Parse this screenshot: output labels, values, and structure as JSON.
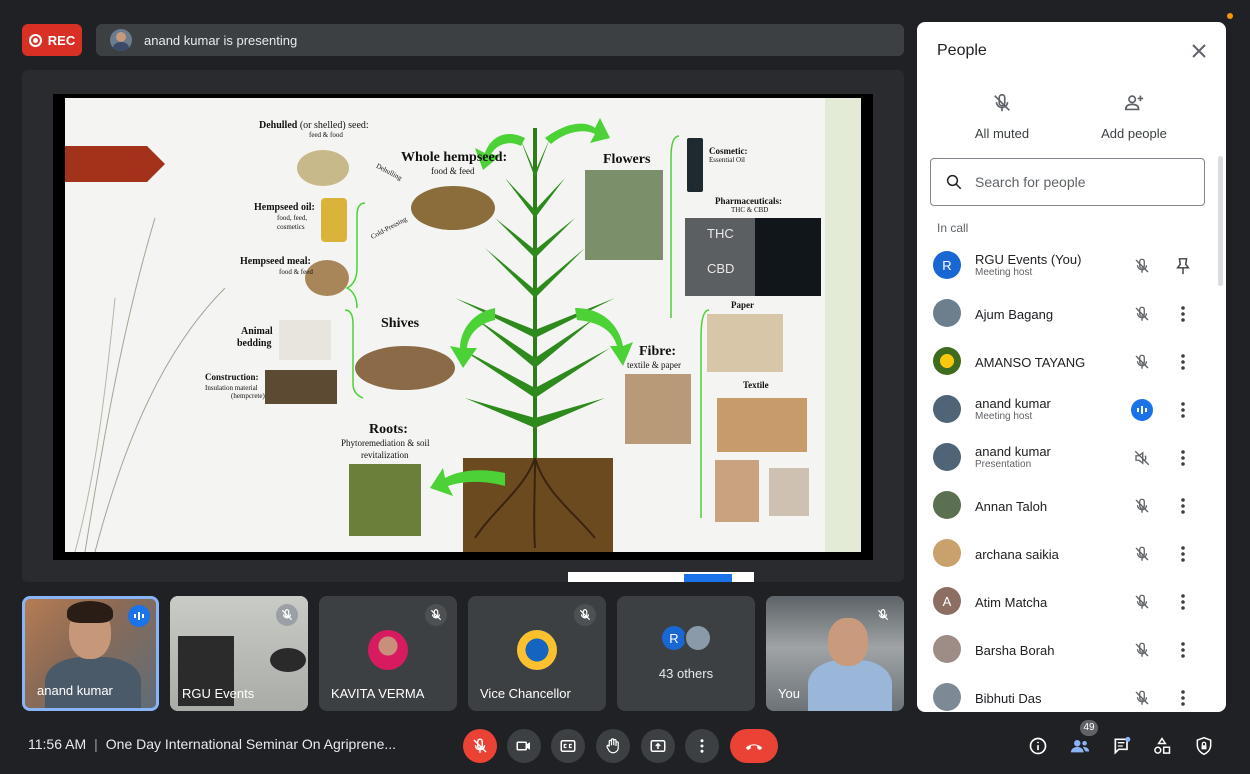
{
  "topbar": {
    "rec_label": "REC",
    "presenting_text": "anand kumar is presenting"
  },
  "slide": {
    "dehulled_title": "Dehulled",
    "dehulled_rest": "(or shelled) seed:",
    "dehulled_sub": "feed & food",
    "whole_title": "Whole hempseed:",
    "whole_sub": "food & feed",
    "dehulling": "Dehulling",
    "cold_pressing": "Cold-Pressing",
    "oil_title": "Hempseed oil:",
    "oil_sub1": "food, feed,",
    "oil_sub2": "cosmetics",
    "meal_title": "Hempseed meal:",
    "meal_sub": "food & feed",
    "animal_title1": "Animal",
    "animal_title2": "bedding",
    "shives_title": "Shives",
    "construction_title": "Construction:",
    "construction_sub1": "Insulation material",
    "construction_sub2": "(hempcrete)",
    "roots_title": "Roots:",
    "roots_sub1": "Phytoremediation & soil",
    "roots_sub2": "revitalization",
    "flowers_title": "Flowers",
    "cosmetic_title": "Cosmetic:",
    "cosmetic_sub": "Essential Oil",
    "pharma_title": "Pharmaceuticals:",
    "pharma_sub": "THC & CBD",
    "thc": "THC",
    "cbd": "CBD",
    "fibre_title": "Fibre:",
    "fibre_sub": "textile & paper",
    "paper_title": "Paper",
    "textile_title": "Textile"
  },
  "tiles": [
    {
      "name": "anand kumar"
    },
    {
      "name": "RGU Events"
    },
    {
      "name": "KAVITA VERMA"
    },
    {
      "name": "Vice Chancellor"
    },
    {
      "name": "43 others",
      "initial": "R"
    },
    {
      "name": "You"
    }
  ],
  "bottom": {
    "time": "11:56 AM",
    "meeting_title": "One Day International Seminar On Agriprene...",
    "people_count": "49"
  },
  "panel": {
    "title": "People",
    "all_muted": "All muted",
    "add_people": "Add people",
    "search_placeholder": "Search for people",
    "in_call": "In call",
    "people": [
      {
        "name": "RGU Events (You)",
        "sub": "Meeting host",
        "initial": "R",
        "color": "#1967d2"
      },
      {
        "name": "Ajum Bagang",
        "sub": "",
        "color": "#6d7f8d"
      },
      {
        "name": "AMANSO TAYANG",
        "sub": "",
        "color": "#3f6b1f"
      },
      {
        "name": "anand kumar",
        "sub": "Meeting host",
        "color": "#4f6477"
      },
      {
        "name": "anand kumar",
        "sub": "Presentation",
        "color": "#4f6477"
      },
      {
        "name": "Annan Taloh",
        "sub": "",
        "color": "#5a7051"
      },
      {
        "name": "archana saikia",
        "sub": "",
        "color": "#c9a16c"
      },
      {
        "name": "Atim Matcha",
        "sub": "",
        "initial": "A",
        "color": "#8d6e63"
      },
      {
        "name": "Barsha Borah",
        "sub": "",
        "color": "#9d8d86"
      },
      {
        "name": "Bibhuti Das",
        "sub": "",
        "color": "#7d8a96"
      }
    ]
  }
}
